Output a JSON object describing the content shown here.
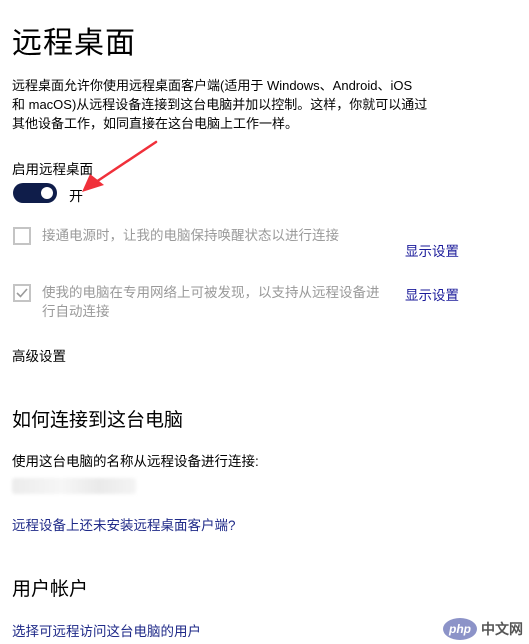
{
  "page": {
    "title": "远程桌面",
    "description_lines": [
      "远程桌面允许你使用远程桌面客户端(适用于 Windows、Android、iOS",
      "和 macOS)从远程设备连接到这台电脑并加以控制。这样，你就可以通过",
      "其他设备工作，如同直接在这台电脑上工作一样。"
    ]
  },
  "remote_desktop": {
    "toggle_label": "启用远程桌面",
    "toggle_state": "开",
    "toggle_on": true
  },
  "options": [
    {
      "text_lines": [
        "接通电源时，让我的电脑保持唤醒状态以进行连接"
      ],
      "checked": false,
      "link": "显示设置"
    },
    {
      "text_lines": [
        "使我的电脑在专用网络上可被发现，以支持从远程设备进",
        "行自动连接"
      ],
      "checked": true,
      "link": "显示设置"
    }
  ],
  "advanced_link": "高级设置",
  "connect_section": {
    "heading": "如何连接到这台电脑",
    "instruction": "使用这台电脑的名称从远程设备进行连接:",
    "client_link": "远程设备上还未安装远程桌面客户端?"
  },
  "accounts_section": {
    "heading": "用户帐户",
    "select_users_link": "选择可远程访问这台电脑的用户"
  },
  "watermark": {
    "logo": "php",
    "text": "中文网"
  },
  "colors": {
    "toggle_on": "#0f1d4a",
    "annotation_arrow": "#f0303a",
    "disabled_text": "#9a9a9a",
    "link": "#1f2a88"
  }
}
